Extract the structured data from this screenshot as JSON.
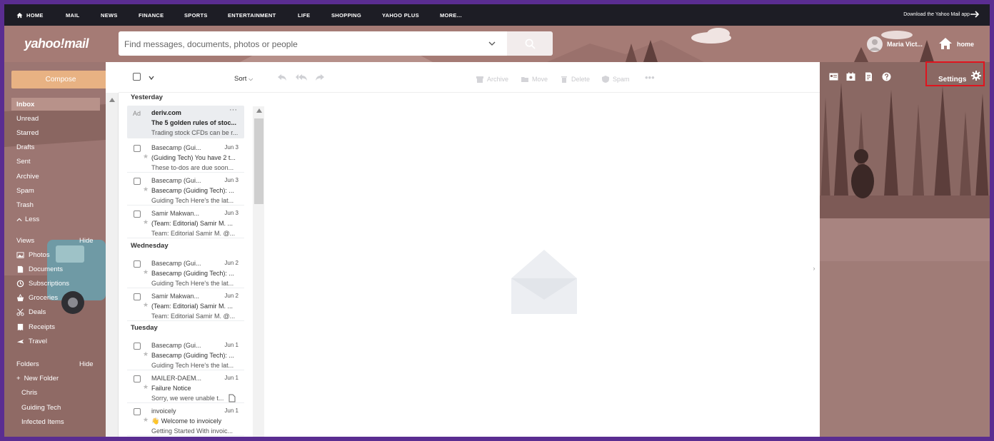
{
  "topnav": {
    "items": [
      "HOME",
      "MAIL",
      "NEWS",
      "FINANCE",
      "SPORTS",
      "ENTERTAINMENT",
      "LIFE",
      "SHOPPING",
      "YAHOO PLUS",
      "MORE..."
    ],
    "download": "Download the Yahoo Mail app"
  },
  "header": {
    "logo": "yahoo!mail",
    "search_placeholder": "Find messages, documents, photos or people",
    "username": "Maria Vict...",
    "home_label": "home"
  },
  "sidebar": {
    "compose": "Compose",
    "items": [
      "Inbox",
      "Unread",
      "Starred",
      "Drafts",
      "Sent",
      "Archive",
      "Spam",
      "Trash",
      "Less"
    ],
    "views_header": "Views",
    "views_hide": "Hide",
    "views": [
      "Photos",
      "Documents",
      "Subscriptions",
      "Groceries",
      "Deals",
      "Receipts",
      "Travel"
    ],
    "folders_header": "Folders",
    "folders_hide": "Hide",
    "new_folder": "New Folder",
    "folders": [
      "Chris",
      "Guiding Tech",
      "Infected Items"
    ]
  },
  "toolbar": {
    "sort": "Sort",
    "archive": "Archive",
    "move": "Move",
    "delete": "Delete",
    "spam": "Spam",
    "settings": "Settings"
  },
  "list": {
    "groups": [
      "Yesterday",
      "Wednesday",
      "Tuesday"
    ],
    "ad": {
      "label": "Ad",
      "from": "deriv.com",
      "subject": "The 5 golden rules of stoc...",
      "snippet": "Trading stock CFDs can be r..."
    },
    "messages": [
      {
        "from": "Basecamp (Gui...",
        "date": "Jun 3",
        "subject": "(Guiding Tech) You have 2 t...",
        "snippet": "These to-dos are due soon..."
      },
      {
        "from": "Basecamp (Gui...",
        "date": "Jun 3",
        "subject": "Basecamp (Guiding Tech): ...",
        "snippet": "Guiding Tech Here's the lat..."
      },
      {
        "from": "Samir Makwan...",
        "date": "Jun 3",
        "subject": "(Team: Editorial) Samir M. ...",
        "snippet": "Team: Editorial Samir M. @..."
      },
      {
        "from": "Basecamp (Gui...",
        "date": "Jun 2",
        "subject": "Basecamp (Guiding Tech): ...",
        "snippet": "Guiding Tech Here's the lat..."
      },
      {
        "from": "Samir Makwan...",
        "date": "Jun 2",
        "subject": "(Team: Editorial) Samir M. ...",
        "snippet": "Team: Editorial Samir M. @..."
      },
      {
        "from": "Basecamp (Gui...",
        "date": "Jun 1",
        "subject": "Basecamp (Guiding Tech): ...",
        "snippet": "Guiding Tech Here's the lat..."
      },
      {
        "from": "MAILER-DAEM...",
        "date": "Jun 1",
        "subject": "Failure Notice",
        "snippet": "Sorry, we were unable t..."
      },
      {
        "from": "invoicely",
        "date": "Jun 1",
        "subject": "👋 Welcome to invoicely",
        "snippet": "Getting Started With invoic..."
      }
    ]
  },
  "colors": {
    "nav_bg": "#1d1d25",
    "compose": "#e8b283",
    "highlight_box": "#e0141e",
    "frame": "#5a2d91"
  }
}
